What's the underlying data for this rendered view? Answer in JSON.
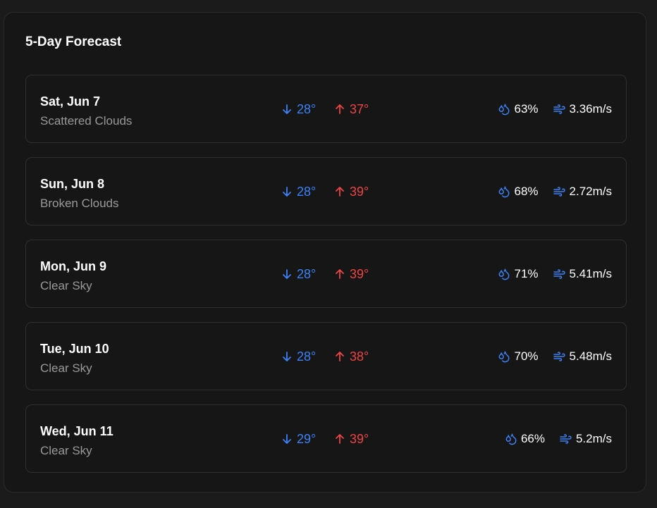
{
  "forecast": {
    "title": "5-Day Forecast",
    "colors": {
      "low": "#3b82f6",
      "high": "#ef4444",
      "icon": "#3b82f6"
    },
    "icons": {
      "low": "arrow-down-icon",
      "high": "arrow-up-icon",
      "humidity": "droplets-icon",
      "wind": "wind-icon"
    },
    "days": [
      {
        "date": "Sat, Jun 7",
        "condition": "Scattered Clouds",
        "low": "28°",
        "high": "37°",
        "humidity": "63%",
        "wind": "3.36m/s"
      },
      {
        "date": "Sun, Jun 8",
        "condition": "Broken Clouds",
        "low": "28°",
        "high": "39°",
        "humidity": "68%",
        "wind": "2.72m/s"
      },
      {
        "date": "Mon, Jun 9",
        "condition": "Clear Sky",
        "low": "28°",
        "high": "39°",
        "humidity": "71%",
        "wind": "5.41m/s"
      },
      {
        "date": "Tue, Jun 10",
        "condition": "Clear Sky",
        "low": "28°",
        "high": "38°",
        "humidity": "70%",
        "wind": "5.48m/s"
      },
      {
        "date": "Wed, Jun 11",
        "condition": "Clear Sky",
        "low": "29°",
        "high": "39°",
        "humidity": "66%",
        "wind": "5.2m/s"
      }
    ]
  }
}
